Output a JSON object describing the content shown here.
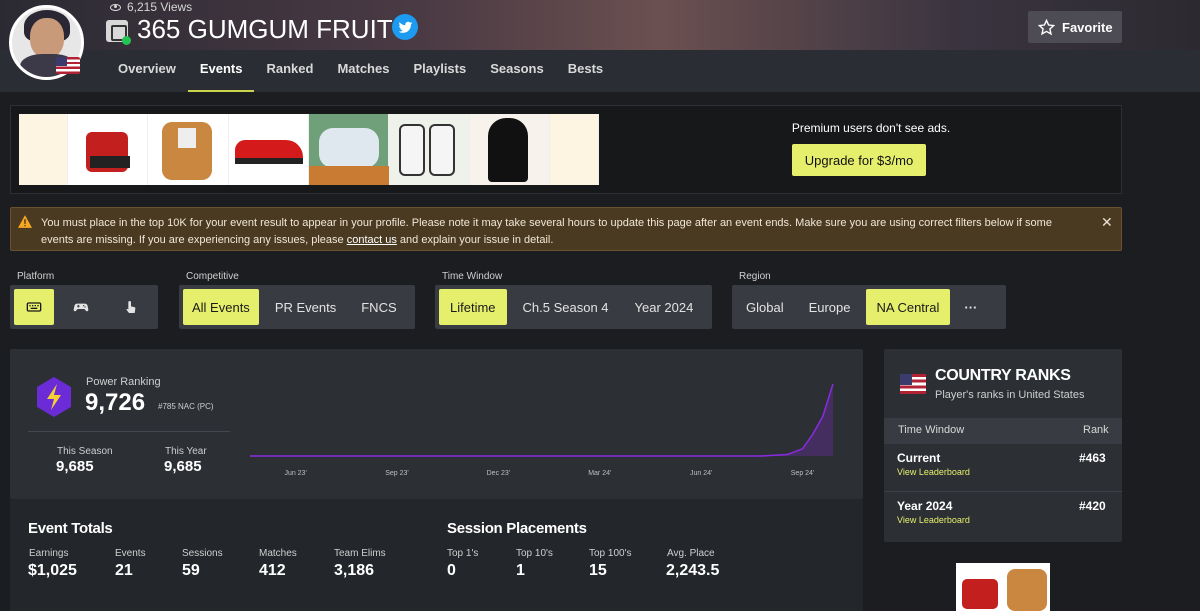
{
  "profile": {
    "views": "6,215 Views",
    "name": "365 GUMGUM FRUIT",
    "avatar_icon": "player-avatar",
    "country_flag_icon": "us-flag-icon",
    "platform_icon": "epic-games-icon",
    "social_icon": "twitter-icon",
    "favorite_label": "Favorite"
  },
  "tabs": [
    {
      "label": "Overview"
    },
    {
      "label": "Events",
      "active": true
    },
    {
      "label": "Ranked"
    },
    {
      "label": "Matches"
    },
    {
      "label": "Playlists"
    },
    {
      "label": "Seasons"
    },
    {
      "label": "Bests"
    }
  ],
  "ad": {
    "premium_text": "Premium users don't see ads.",
    "upgrade_label": "Upgrade for $3/mo"
  },
  "warning": {
    "text_before": "You must place in the top 10K for your event result to appear in your profile. Please note it may take several hours to update this page after an event ends. Make sure you are using correct filters below if some events are missing. If you are experiencing any issues, please ",
    "link": "contact us",
    "text_after": " and explain your issue in detail.",
    "close": "✕"
  },
  "filters": {
    "platform": {
      "label": "Platform",
      "options": [
        "keyboard-mouse-icon",
        "controller-icon",
        "touch-icon"
      ],
      "selected": 0
    },
    "competitive": {
      "label": "Competitive",
      "options": [
        "All Events",
        "PR Events",
        "FNCS"
      ],
      "selected": "All Events"
    },
    "time_window": {
      "label": "Time Window",
      "options": [
        "Lifetime",
        "Ch.5 Season 4",
        "Year 2024"
      ],
      "selected": "Lifetime"
    },
    "region": {
      "label": "Region",
      "options": [
        "Global",
        "Europe",
        "NA Central"
      ],
      "selected": "NA Central",
      "more": "···"
    }
  },
  "power_ranking": {
    "label": "Power Ranking",
    "value": "9,726",
    "rank": "#785 NAC (PC)",
    "this_season_label": "This Season",
    "this_season": "9,685",
    "this_year_label": "This Year",
    "this_year": "9,685"
  },
  "chart_data": {
    "type": "area",
    "title": "",
    "x_ticks": [
      "Jun 23'",
      "Sep 23'",
      "Dec 23'",
      "Mar 24'",
      "Jun 24'",
      "Sep 24'"
    ],
    "series": [
      {
        "x": [
          0,
          1,
          2,
          3,
          4,
          4.6,
          4.85,
          5.0,
          5.1,
          5.2,
          5.3
        ],
        "values": [
          0,
          0,
          0,
          0,
          0,
          0,
          2,
          10,
          30,
          55,
          100
        ]
      }
    ],
    "ylim": [
      0,
      100
    ],
    "color": "#8a2be2"
  },
  "event_totals": {
    "title": "Event Totals",
    "items": [
      {
        "label": "Earnings",
        "value": "$1,025"
      },
      {
        "label": "Events",
        "value": "21"
      },
      {
        "label": "Sessions",
        "value": "59"
      },
      {
        "label": "Matches",
        "value": "412"
      },
      {
        "label": "Team Elims",
        "value": "3,186"
      }
    ]
  },
  "session_placements": {
    "title": "Session Placements",
    "items": [
      {
        "label": "Top 1's",
        "value": "0"
      },
      {
        "label": "Top 10's",
        "value": "1"
      },
      {
        "label": "Top 100's",
        "value": "15"
      },
      {
        "label": "Avg. Place",
        "value": "2,243.5"
      }
    ]
  },
  "country_ranks": {
    "title": "COUNTRY RANKS",
    "subtitle": "Player's ranks in United States",
    "col_left": "Time Window",
    "col_right": "Rank",
    "rows": [
      {
        "name": "Current",
        "link": "View Leaderboard",
        "rank": "#463"
      },
      {
        "name": "Year 2024",
        "link": "View Leaderboard",
        "rank": "#420"
      }
    ]
  },
  "colors": {
    "accent": "#e6ef6c",
    "background": "#1b1d20",
    "panel": "#2c2f34",
    "chart_line": "#8a2be2"
  }
}
